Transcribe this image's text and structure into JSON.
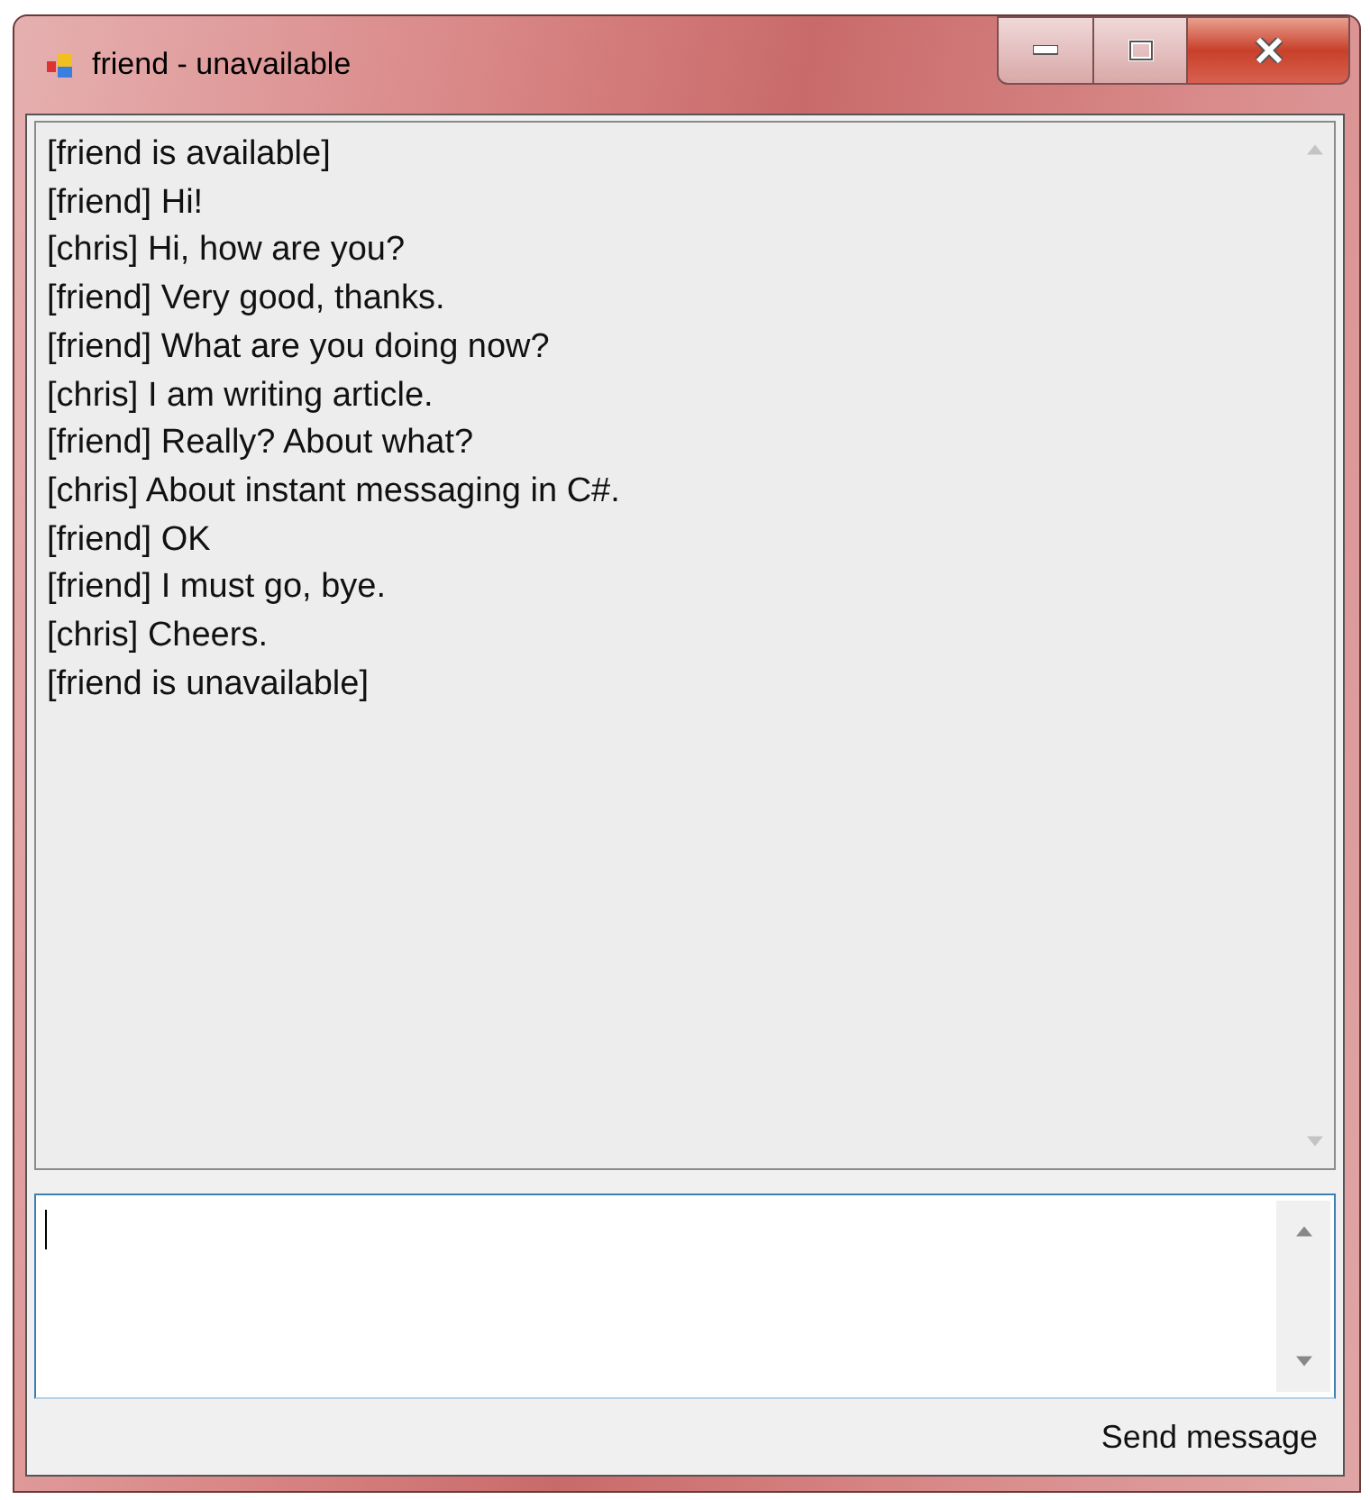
{
  "window": {
    "title": "friend - unavailable",
    "controls": [
      {
        "kind": "minimize"
      },
      {
        "kind": "maximize"
      },
      {
        "kind": "close"
      }
    ]
  },
  "messages": [
    "[friend is available]",
    "[friend] Hi!",
    "[chris] Hi, how are you?",
    "[friend] Very good, thanks.",
    "[friend] What are you doing now?",
    "[chris] I am writing article.",
    "[friend] Really? About what?",
    "[chris] About instant messaging in C#.",
    "[friend] OK",
    "[friend] I must go, bye.",
    "[chris] Cheers.",
    "[friend is unavailable]"
  ],
  "send_button": {
    "label": "Send message"
  }
}
